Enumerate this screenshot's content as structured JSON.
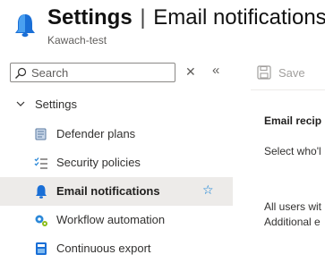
{
  "header": {
    "title": "Settings",
    "separator": "|",
    "page": "Email notifications",
    "subtitle": "Kawach-test"
  },
  "search": {
    "placeholder": "Search"
  },
  "toolbar": {
    "save_label": "Save"
  },
  "nav": {
    "group_label": "Settings",
    "items": [
      {
        "label": "Defender plans",
        "icon": "defender-plans-icon"
      },
      {
        "label": "Security policies",
        "icon": "security-policies-icon"
      },
      {
        "label": "Email notifications",
        "icon": "bell-icon",
        "active": true
      },
      {
        "label": "Workflow automation",
        "icon": "workflow-icon"
      },
      {
        "label": "Continuous export",
        "icon": "export-icon"
      }
    ]
  },
  "content": {
    "heading": "Email recip",
    "line1": "Select who'l",
    "line2": "All users wit",
    "line3": "Additional e"
  },
  "colors": {
    "accent": "#0078d4",
    "active_bg": "#edebe9"
  }
}
